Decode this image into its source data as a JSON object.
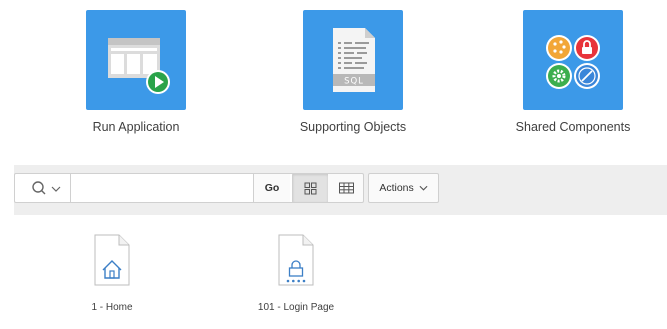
{
  "tiles": [
    {
      "label": "Run Application",
      "icon": "run-application-icon"
    },
    {
      "label": "Supporting Objects",
      "icon": "supporting-objects-icon",
      "badge": "SQL"
    },
    {
      "label": "Shared Components",
      "icon": "shared-components-icon"
    }
  ],
  "toolbar": {
    "search_icon": "search-icon",
    "search_value": "",
    "search_placeholder": "",
    "go_label": "Go",
    "view_options": [
      "icon-view",
      "report-view"
    ],
    "active_view": "icon-view",
    "actions_label": "Actions"
  },
  "pages": [
    {
      "label": "1 - Home",
      "icon": "home-page-icon"
    },
    {
      "label": "101 - Login Page",
      "icon": "login-page-icon"
    }
  ],
  "colors": {
    "tile_blue": "#3c99e8",
    "play_green": "#2aa34a",
    "lock_red": "#e8333a",
    "gear_green": "#3cae4e",
    "compass_blue": "#3a86d9",
    "palette_orange": "#f2a637",
    "page_icon_blue": "#3c7fc6",
    "toolbar_bg": "#eeeeee"
  }
}
